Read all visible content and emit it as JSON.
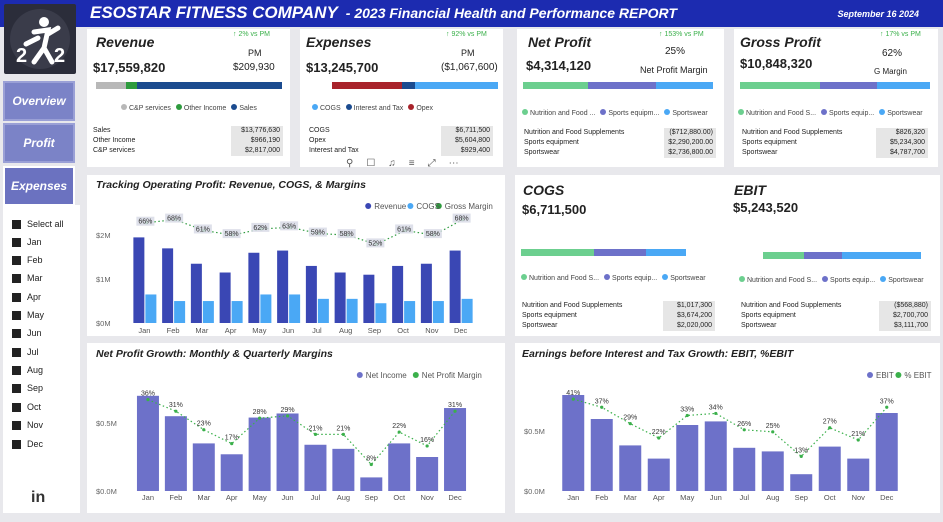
{
  "header": {
    "company": "ESOSTAR FITNESS COMPANY",
    "subtitle": "- 2023 Financial Health and Performance REPORT",
    "date": "September 16 2024"
  },
  "nav": [
    {
      "label": "Overview"
    },
    {
      "label": "Profit"
    },
    {
      "label": "Expenses"
    }
  ],
  "months_filter": [
    "Select all",
    "Jan",
    "Feb",
    "Mar",
    "Apr",
    "May",
    "Jun",
    "Jul",
    "Aug",
    "Sep",
    "Oct",
    "Nov",
    "Dec"
  ],
  "kpi": {
    "revenue": {
      "title": "Revenue",
      "value": "$17,559,820",
      "trend": "↑ 2% vs PM",
      "pm_label": "PM",
      "pm_value": "$209,930",
      "legend": [
        "C&P services",
        "Other Income",
        "Sales"
      ],
      "rows": [
        [
          "Sales",
          "$13,776,630"
        ],
        [
          "Other Income",
          "$966,190"
        ],
        [
          "C&P services",
          "$2,817,000"
        ]
      ]
    },
    "expenses": {
      "title": "Expenses",
      "value": "$13,245,700",
      "trend": "↑ 92% vs PM",
      "pm_label": "PM",
      "pm_value": "($1,067,600)",
      "legend": [
        "COGS",
        "Interest and Tax",
        "Opex"
      ],
      "rows": [
        [
          "COGS",
          "$6,711,500"
        ],
        [
          "Opex",
          "$5,604,800"
        ],
        [
          "Interest and Tax",
          "$929,400"
        ]
      ]
    },
    "net_profit": {
      "title": "Net Profit",
      "value": "$4,314,120",
      "trend": "↑ 153% vs PM",
      "pct": "25%",
      "pct_label": "Net Profit Margin",
      "legend": [
        "Nutrition and Food ...",
        "Sports equipm...",
        "Sportswear"
      ],
      "rows": [
        [
          "Nutrition and Food Supplements",
          "($712,880.00)"
        ],
        [
          "Sports equipment",
          "$2,290,200.00"
        ],
        [
          "Sportswear",
          "$2,736,800.00"
        ]
      ]
    },
    "gross_profit": {
      "title": "Gross Profit",
      "value": "$10,848,320",
      "trend": "↑ 17% vs PM",
      "pct": "62%",
      "pct_label": "G Margin",
      "legend": [
        "Nutrition and Food S...",
        "Sports equip...",
        "Sportswear"
      ],
      "rows": [
        [
          "Nutrition and Food Supplements",
          "$826,320"
        ],
        [
          "Sports equipment",
          "$5,234,300"
        ],
        [
          "Sportswear",
          "$4,787,700"
        ]
      ]
    },
    "cogs": {
      "title": "COGS",
      "value": "$6,711,500",
      "legend": [
        "Nutrition and Food S...",
        "Sports equip...",
        "Sportswear"
      ],
      "rows": [
        [
          "Nutrition and Food Supplements",
          "$1,017,300"
        ],
        [
          "Sports equipment",
          "$3,674,200"
        ],
        [
          "Sportswear",
          "$2,020,000"
        ]
      ]
    },
    "ebit": {
      "title": "EBIT",
      "value": "$5,243,520",
      "legend": [
        "Nutrition and Food S...",
        "Sports equip...",
        "Sportswear"
      ],
      "rows": [
        [
          "Nutrition and Food Supplements",
          "($568,880)"
        ],
        [
          "Sports equipment",
          "$2,700,700"
        ],
        [
          "Sportswear",
          "$3,111,700"
        ]
      ]
    }
  },
  "colors": {
    "navy": "#3a47b4",
    "light_blue": "#4aa8f5",
    "green": "#2e9b3e",
    "purple": "#6d71c9",
    "teal_green": "#6ccf8f",
    "red": "#a8232b",
    "gray": "#b8b8b8"
  },
  "chart_data": [
    {
      "type": "bar",
      "title": "Tracking Operating Profit: Revenue, COGS, & Margins",
      "categories": [
        "Jan",
        "Feb",
        "Mar",
        "Apr",
        "May",
        "Jun",
        "Jul",
        "Aug",
        "Sep",
        "Oct",
        "Nov",
        "Dec"
      ],
      "series": [
        {
          "name": "Revenue",
          "values": [
            1.95,
            1.7,
            1.35,
            1.15,
            1.6,
            1.65,
            1.3,
            1.15,
            1.1,
            1.3,
            1.35,
            1.65
          ]
        },
        {
          "name": "COGS",
          "values": [
            0.65,
            0.5,
            0.5,
            0.5,
            0.65,
            0.65,
            0.55,
            0.55,
            0.45,
            0.5,
            0.5,
            0.55
          ]
        },
        {
          "name": "Gross Margin",
          "values": [
            66,
            68,
            61,
            58,
            62,
            63,
            59,
            58,
            52,
            61,
            58,
            68
          ]
        }
      ],
      "data_labels": [
        "66%",
        "68%",
        "61%",
        "58%",
        "62%",
        "63%",
        "59%",
        "58%",
        "52%",
        "61%",
        "58%",
        "68%"
      ],
      "yticks": [
        "$0M",
        "$1M",
        "$2M"
      ],
      "ylim": [
        0,
        2.05
      ],
      "legend": "top-right"
    },
    {
      "type": "bar",
      "title": "Net Profit Growth: Monthly & Quarterly Margins",
      "categories": [
        "Jan",
        "Feb",
        "Mar",
        "Apr",
        "May",
        "Jun",
        "Jul",
        "Aug",
        "Sep",
        "Oct",
        "Nov",
        "Dec"
      ],
      "series": [
        {
          "name": "Net Income",
          "values": [
            0.7,
            0.55,
            0.35,
            0.27,
            0.54,
            0.57,
            0.34,
            0.31,
            0.1,
            0.35,
            0.25,
            0.61
          ]
        },
        {
          "name": "Net Profit Margin",
          "values": [
            36,
            31,
            23,
            17,
            28,
            29,
            21,
            21,
            8,
            22,
            16,
            31
          ]
        }
      ],
      "data_labels": [
        "36%",
        "31%",
        "23%",
        "17%",
        "28%",
        "29%",
        "21%",
        "21%",
        "8%",
        "22%",
        "16%",
        "31%"
      ],
      "yticks": [
        "$0.0M",
        "$0.5M"
      ],
      "ylim": [
        0,
        0.75
      ],
      "legend": "top-right"
    },
    {
      "type": "bar",
      "title": "Earnings before Interest and Tax Growth: EBIT, %EBIT",
      "categories": [
        "Jan",
        "Feb",
        "Mar",
        "Apr",
        "May",
        "Jun",
        "Jul",
        "Aug",
        "Sep",
        "Oct",
        "Nov",
        "Dec"
      ],
      "series": [
        {
          "name": "EBIT",
          "values": [
            0.8,
            0.6,
            0.38,
            0.27,
            0.55,
            0.58,
            0.36,
            0.33,
            0.14,
            0.37,
            0.27,
            0.65
          ]
        },
        {
          "name": "% EBIT",
          "values": [
            41,
            37,
            29,
            22,
            33,
            34,
            26,
            25,
            13,
            27,
            21,
            37
          ]
        }
      ],
      "data_labels": [
        "41%",
        "37%",
        "29%",
        "22%",
        "33%",
        "34%",
        "26%",
        "25%",
        "13%",
        "27%",
        "21%",
        "37%"
      ],
      "yticks": [
        "$0.0M",
        "$0.5M"
      ],
      "ylim": [
        0,
        0.85
      ],
      "legend": "top-right"
    }
  ]
}
